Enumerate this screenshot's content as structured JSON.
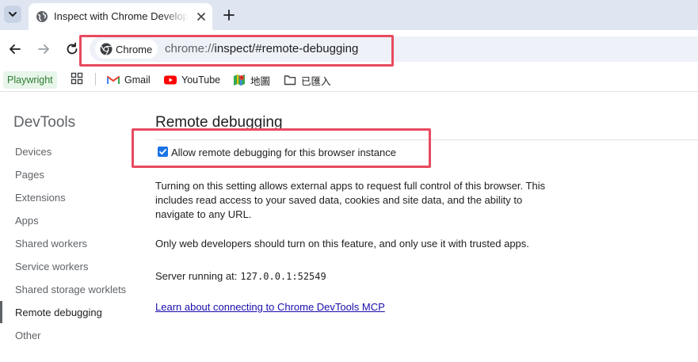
{
  "tab": {
    "title": "Inspect with Chrome Developer Tools"
  },
  "omnibox": {
    "chip_label": "Chrome",
    "url_scheme": "chrome://",
    "url_rest": "inspect/#remote-debugging"
  },
  "bookmarks": [
    {
      "label": "Playwright",
      "icon": ""
    },
    {
      "label": "Gmail",
      "icon": "gmail-icon"
    },
    {
      "label": "YouTube",
      "icon": "youtube-icon"
    },
    {
      "label": "地圖",
      "icon": "maps-icon"
    },
    {
      "label": "已匯入",
      "icon": "folder-icon"
    }
  ],
  "sidebar": {
    "title": "DevTools",
    "items": [
      {
        "label": "Devices"
      },
      {
        "label": "Pages"
      },
      {
        "label": "Extensions"
      },
      {
        "label": "Apps"
      },
      {
        "label": "Shared workers"
      },
      {
        "label": "Service workers"
      },
      {
        "label": "Shared storage worklets"
      },
      {
        "label": "Remote debugging"
      },
      {
        "label": "Other"
      }
    ]
  },
  "main": {
    "title": "Remote debugging",
    "checkbox_label": "Allow remote debugging for this browser instance",
    "checkbox_checked": true,
    "paragraph1": "Turning on this setting allows external apps to request full control of this browser. This includes read access to your saved data, cookies and site data, and the ability to navigate to any URL.",
    "paragraph2": "Only web developers should turn on this feature, and only use it with trusted apps.",
    "server_label": "Server running at:",
    "server_address": "127.0.0.1:52549",
    "link_text": "Learn about connecting to Chrome DevTools MCP"
  },
  "colors": {
    "accent": "#1a73e8",
    "annotation": "#e84a5f",
    "link": "#1a0dab"
  }
}
